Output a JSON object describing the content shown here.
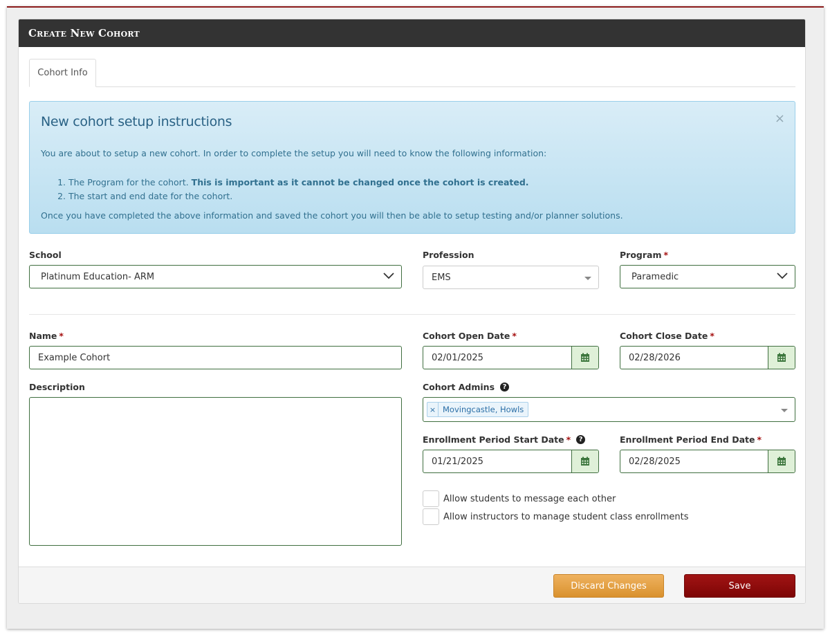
{
  "panel": {
    "title": "Create New Cohort"
  },
  "tabs": [
    {
      "label": "Cohort Info"
    }
  ],
  "alert": {
    "heading": "New cohort setup instructions",
    "close": "×",
    "intro": "You are about to setup a new cohort. In order to complete the setup you will need to know the following information:",
    "item1_text": "The Program for the cohort. ",
    "item1_bold": "This is important as it cannot be changed once the cohort is created.",
    "item2_text": "The start and end date for the cohort.",
    "outro": "Once you have completed the above information and saved the cohort you will then be able to setup testing and/or planner solutions."
  },
  "form": {
    "school": {
      "label": "School",
      "value": "Platinum Education- ARM"
    },
    "profession": {
      "label": "Profession",
      "value": "EMS"
    },
    "program": {
      "label": "Program",
      "value": "Paramedic"
    },
    "name": {
      "label": "Name",
      "value": "Example Cohort"
    },
    "description": {
      "label": "Description"
    },
    "open_date": {
      "label": "Cohort Open Date",
      "value": "02/01/2025"
    },
    "close_date": {
      "label": "Cohort Close Date",
      "value": "02/28/2026"
    },
    "admins": {
      "label": "Cohort Admins",
      "tags": [
        "Movingcastle, Howls"
      ],
      "tag_remove": "×"
    },
    "enroll_start": {
      "label": "Enrollment Period Start Date",
      "value": "01/21/2025"
    },
    "enroll_end": {
      "label": "Enrollment Period End Date",
      "value": "02/28/2025"
    },
    "required_mark": "*",
    "help_mark": "?",
    "checkboxes": [
      {
        "label": "Allow students to message each other",
        "checked": false
      },
      {
        "label": "Allow instructors to manage student class enrollments",
        "checked": false
      }
    ]
  },
  "footer": {
    "discard_label": "Discard Changes",
    "save_label": "Save"
  },
  "colors": {
    "header_bg": "#333333",
    "field_border": "#3f6e3f",
    "required": "#a51010",
    "save": "#8b0a0a",
    "discard": "#e5a245",
    "alert_bg": "#c9e6f4"
  }
}
